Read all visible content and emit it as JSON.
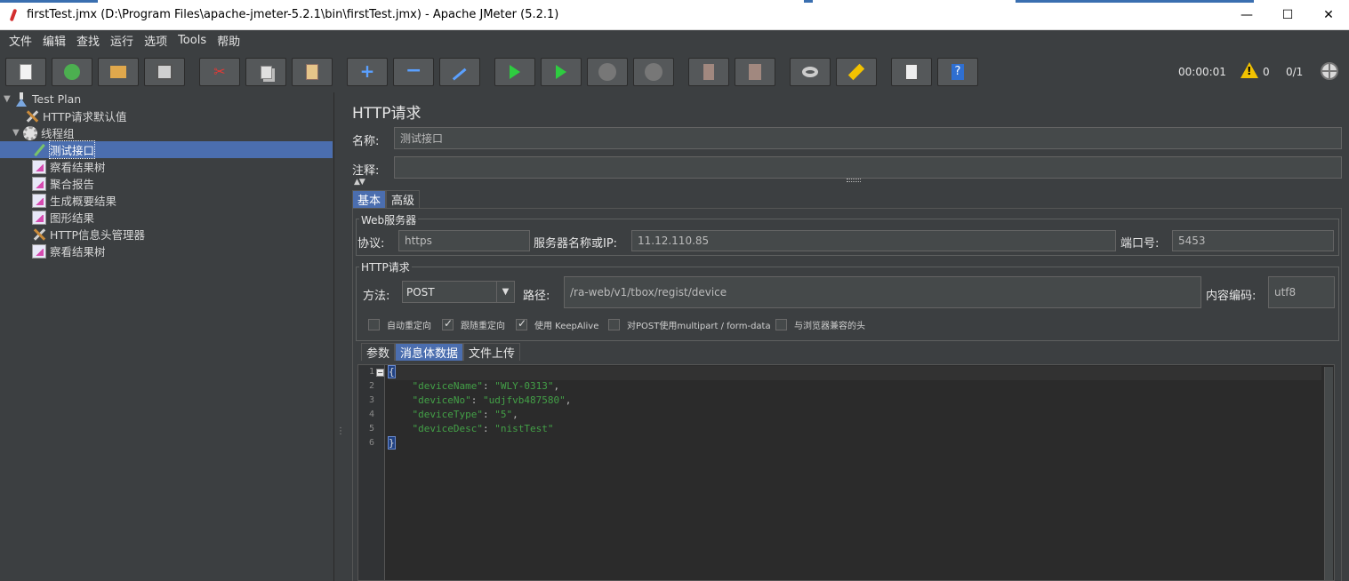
{
  "window": {
    "title": "firstTest.jmx (D:\\Program Files\\apache-jmeter-5.2.1\\bin\\firstTest.jmx) - Apache JMeter (5.2.1)",
    "controls": [
      "—",
      "☐",
      "✕"
    ]
  },
  "menu": [
    "文件",
    "编辑",
    "查找",
    "运行",
    "选项",
    "Tools",
    "帮助"
  ],
  "toolbar": {
    "buttons": [
      "new-icon",
      "templates-icon",
      "open-icon",
      "save-icon",
      "cut-icon",
      "copy-icon",
      "paste-icon",
      "expand-icon",
      "collapse-icon",
      "toggle-icon",
      "start-icon",
      "start-no-pause-icon",
      "stop-icon",
      "shutdown-icon",
      "clear-icon",
      "clear-all-icon",
      "search-icon",
      "reset-search-icon",
      "function-helper-icon",
      "help-icon"
    ],
    "elapsed": "00:00:01",
    "warnings": "0",
    "threads": "0/1",
    "status_color": "#f2c200"
  },
  "tree": {
    "items": [
      {
        "label": "Test Plan",
        "icon": "test-plan-icon"
      },
      {
        "label": "HTTP请求默认值",
        "icon": "config-tool-icon"
      },
      {
        "label": "线程组",
        "icon": "thread-group-icon"
      },
      {
        "label": "测试接口",
        "icon": "sampler-icon"
      },
      {
        "label": "察看结果树",
        "icon": "listener-icon"
      },
      {
        "label": "聚合报告",
        "icon": "listener-icon"
      },
      {
        "label": "生成概要结果",
        "icon": "listener-icon"
      },
      {
        "label": "图形结果",
        "icon": "listener-icon"
      },
      {
        "label": "HTTP信息头管理器",
        "icon": "config-tool-icon"
      },
      {
        "label": "察看结果树",
        "icon": "listener-icon"
      }
    ],
    "selected_color": "#4b6eaf"
  },
  "panel": {
    "title": "HTTP请求",
    "name_label": "名称:",
    "name_value": "测试接口",
    "comment_label": "注释:",
    "comment_value": "",
    "tabs": [
      "基本",
      "高级"
    ],
    "web_server": {
      "group_title": "Web服务器",
      "protocol_label": "协议:",
      "protocol_value": "https",
      "server_label": "服务器名称或IP:",
      "server_value": "11.12.110.85",
      "port_label": "端口号:",
      "port_value": "5453"
    },
    "http_request": {
      "group_title": "HTTP请求",
      "method_label": "方法:",
      "method_value": "POST",
      "path_label": "路径:",
      "path_value": "/ra-web/v1/tbox/regist/device",
      "encoding_label": "内容编码:",
      "encoding_value": "utf8"
    },
    "checkboxes": [
      {
        "label": "自动重定向",
        "checked": false
      },
      {
        "label": "跟随重定向",
        "checked": true
      },
      {
        "label": "使用 KeepAlive",
        "checked": true
      },
      {
        "label": "对POST使用multipart / form-data",
        "checked": false
      },
      {
        "label": "与浏览器兼容的头",
        "checked": false
      }
    ],
    "body_tabs": [
      "参数",
      "消息体数据",
      "文件上传"
    ],
    "code": {
      "line_numbers": [
        "1",
        "2",
        "3",
        "4",
        "5",
        "6"
      ],
      "open_brace": "{",
      "close_brace": "}",
      "entries": [
        {
          "key": "\"deviceName\"",
          "value": "\"WLY-0313\"",
          "comma": ","
        },
        {
          "key": "\"deviceNo\"",
          "value": "\"udjfvb487580\"",
          "comma": ","
        },
        {
          "key": "\"deviceType\"",
          "value": "\"5\"",
          "comma": ","
        },
        {
          "key": "\"deviceDesc\"",
          "value": "\"nistTest\"",
          "comma": ""
        }
      ],
      "colon": ": "
    }
  }
}
